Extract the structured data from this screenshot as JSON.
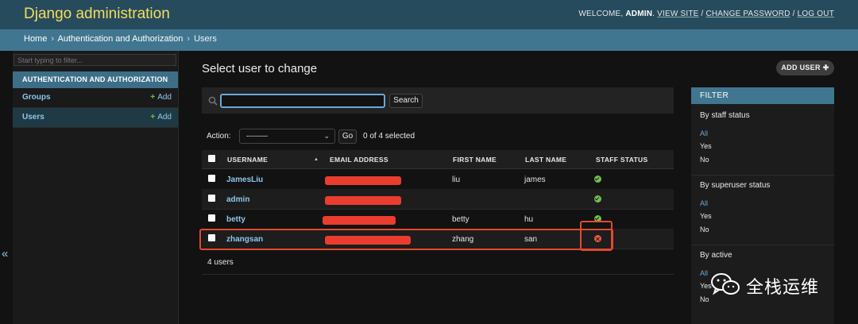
{
  "header": {
    "title": "Django administration",
    "welcome": "WELCOME,",
    "username": "ADMIN",
    "view_site": "VIEW SITE",
    "change_password": "CHANGE PASSWORD",
    "log_out": "LOG OUT",
    "sep": "/"
  },
  "breadcrumbs": [
    "Home",
    "Authentication and Authorization",
    "Users"
  ],
  "breadcrumb_sep": "›",
  "sidebar": {
    "filter_placeholder": "Start typing to filter...",
    "app_caption": "AUTHENTICATION AND AUTHORIZATION",
    "models": [
      {
        "name": "Groups",
        "add": "Add",
        "selected": false
      },
      {
        "name": "Users",
        "add": "Add",
        "selected": true
      }
    ],
    "collapse_label": "«"
  },
  "main": {
    "title": "Select user to change",
    "add_user": "ADD USER",
    "search_value": "",
    "search_button": "Search",
    "action_label": "Action:",
    "action_selected": "---------",
    "go_button": "Go",
    "selected_count": "0 of 4 selected",
    "columns": [
      "USERNAME",
      "EMAIL ADDRESS",
      "FIRST NAME",
      "LAST NAME",
      "STAFF STATUS"
    ],
    "rows": [
      {
        "username": "JamesLiu",
        "first": "liu",
        "last": "james",
        "staff": true
      },
      {
        "username": "admin",
        "first": "",
        "last": "",
        "staff": true
      },
      {
        "username": "betty",
        "first": "betty",
        "last": "hu",
        "staff": true
      },
      {
        "username": "zhangsan",
        "first": "zhang",
        "last": "san",
        "staff": false
      }
    ],
    "result_count": "4 users"
  },
  "filter": {
    "title": "FILTER",
    "sections": [
      {
        "title": "By staff status",
        "options": [
          "All",
          "Yes",
          "No"
        ]
      },
      {
        "title": "By superuser status",
        "options": [
          "All",
          "Yes",
          "No"
        ]
      },
      {
        "title": "By active",
        "options": [
          "All",
          "Yes",
          "No"
        ]
      }
    ]
  },
  "watermark": {
    "text": "全栈运维",
    "icon": "wechat-icon"
  },
  "colors": {
    "header_bg": "#264b5d",
    "breadcrumb_bg": "#417690",
    "brand_yellow": "#f5dd5d",
    "link": "#8ec6ea",
    "accent_red": "#e34a2e",
    "ok_green": "#6fc14a"
  }
}
